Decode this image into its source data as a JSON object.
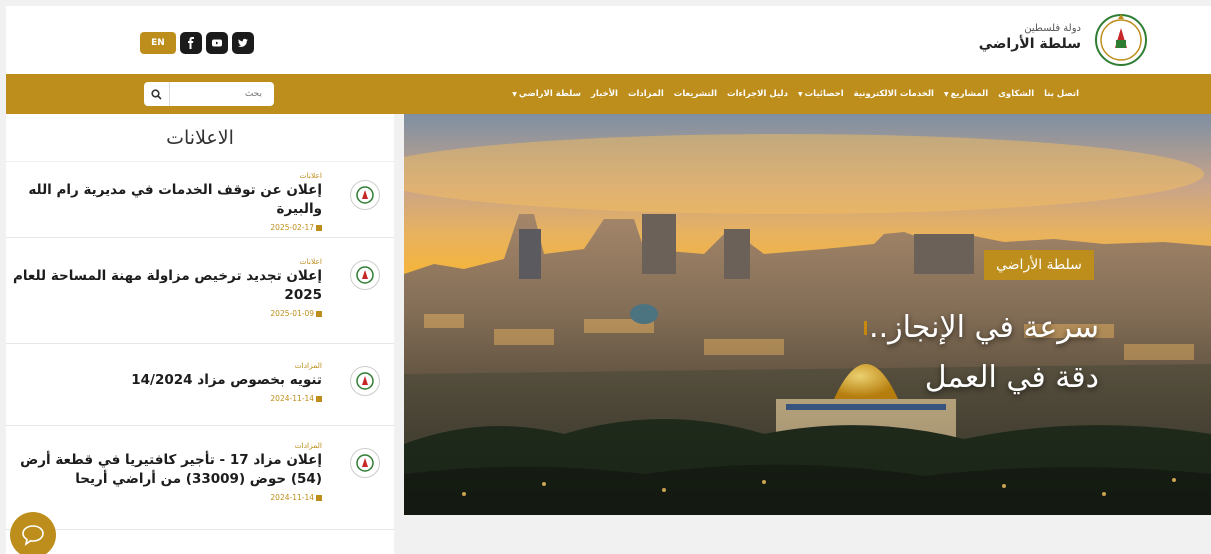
{
  "header": {
    "brand_top": "دولة فلسطين",
    "brand_main": "سلطة الأراضي",
    "lang_label": "EN",
    "social": [
      "facebook-icon",
      "youtube-icon",
      "twitter-icon"
    ]
  },
  "nav": {
    "items": [
      {
        "label": "سلطة الاراضي",
        "dropdown": true
      },
      {
        "label": "الأخبار",
        "dropdown": false
      },
      {
        "label": "المزادات",
        "dropdown": false
      },
      {
        "label": "التشريعات",
        "dropdown": false
      },
      {
        "label": "دليل الاجراءات",
        "dropdown": false
      },
      {
        "label": "احصائيات",
        "dropdown": true
      },
      {
        "label": "الخدمات الالكترونية",
        "dropdown": false
      },
      {
        "label": "المشاريع",
        "dropdown": true
      },
      {
        "label": "الشكاوى",
        "dropdown": false
      },
      {
        "label": "اتصل بنا",
        "dropdown": false
      }
    ],
    "search_placeholder": "بحث"
  },
  "sidebar": {
    "title": "الاعلانات",
    "items": [
      {
        "category": "اعلانات",
        "title": "إعلان عن توقف الخدمات في مديرية رام الله والبيرة",
        "date": "2025-02-17"
      },
      {
        "category": "اعلانات",
        "title": "إعلان تجديد ترخيص مزاولة مهنة المساحة للعام 2025",
        "date": "2025-01-09"
      },
      {
        "category": "المزادات",
        "title": "تنويه بخصوص مزاد 14/2024",
        "date": "2024-11-14"
      },
      {
        "category": "المزادات",
        "title": "إعلان مزاد 17 - تأجير كافتيريا في قطعة أرض (54) حوض (33009) من أراضي أريحا",
        "date": "2024-11-14"
      }
    ]
  },
  "hero": {
    "badge": "سلطة الأراضي",
    "line1": "سرعة في الإنجاز..",
    "line2": "دقة في العمل"
  },
  "colors": {
    "accent": "#bd8e1b"
  }
}
